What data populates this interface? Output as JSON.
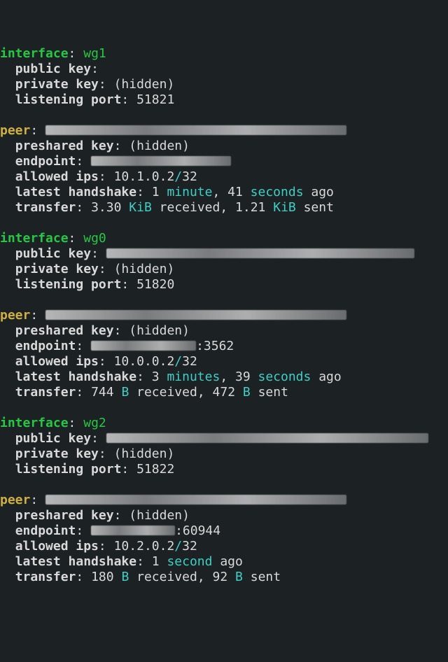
{
  "labels": {
    "interface": "interface",
    "public_key": "public key",
    "private_key": "private key",
    "listening_port": "listening port",
    "peer": "peer",
    "preshared_key": "preshared key",
    "endpoint": "endpoint",
    "allowed_ips": "allowed ips",
    "latest_handshake": "latest handshake",
    "transfer": "transfer"
  },
  "words": {
    "hidden": "(hidden)",
    "received": "received",
    "sent": "sent",
    "ago": "ago",
    "minute": "minute",
    "minutes": "minutes",
    "second": "second",
    "seconds": "seconds"
  },
  "blocks": [
    {
      "iface": "wg1",
      "port": "51821",
      "peer": {
        "endpoint_port": "",
        "ip": "10.1.0.2",
        "mask": "/32",
        "hs": [
          "1",
          "minute",
          ", 41 ",
          "seconds",
          " ago"
        ],
        "tx_rx": "3.30",
        "rx_unit": "KiB",
        "tx": "1.21",
        "tx_unit": "KiB"
      }
    },
    {
      "iface": "wg0",
      "port": "51820",
      "peer": {
        "endpoint_port": ":3562",
        "ip": "10.0.0.2",
        "mask": "/32",
        "hs": [
          "3",
          "minutes",
          ", 39 ",
          "seconds",
          " ago"
        ],
        "tx_rx": "744",
        "rx_unit": "B",
        "tx": "472",
        "tx_unit": "B"
      }
    },
    {
      "iface": "wg2",
      "port": "51822",
      "peer": {
        "endpoint_port": ":60944",
        "ip": "10.2.0.2",
        "mask": "/32",
        "hs": [
          "1",
          "second",
          " ago"
        ],
        "tx_rx": "180",
        "rx_unit": "B",
        "tx": "92",
        "tx_unit": "B"
      }
    }
  ]
}
